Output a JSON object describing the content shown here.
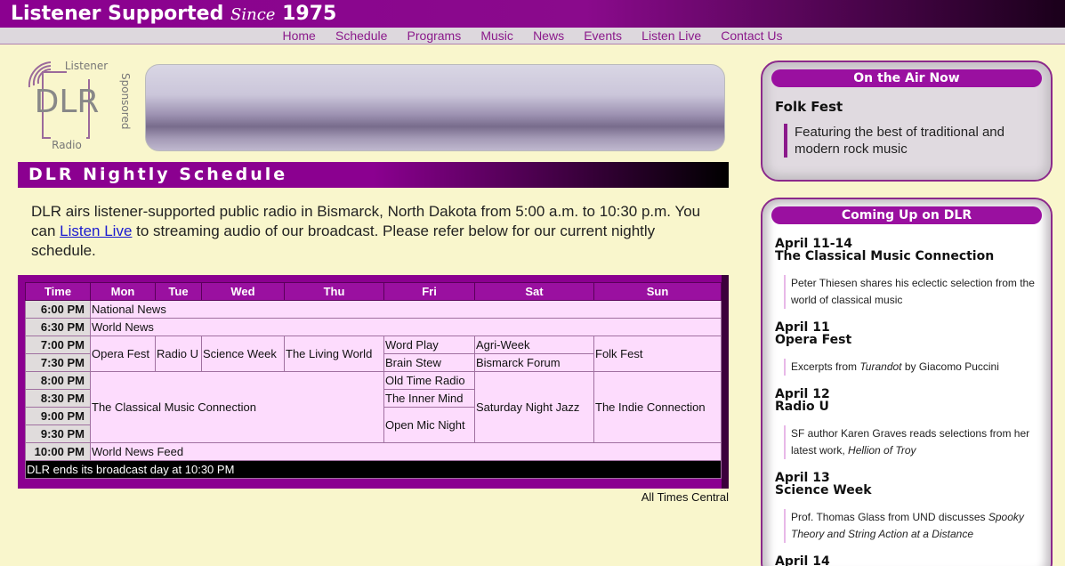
{
  "header": {
    "title": "Listener Supported",
    "since": "Since",
    "year": "1975"
  },
  "nav": [
    "Home",
    "Schedule",
    "Programs",
    "Music",
    "News",
    "Events",
    "Listen Live",
    "Contact Us"
  ],
  "logo": {
    "top": "Listener",
    "mid": "DLR",
    "side": "Sponsored",
    "bottom": "Radio"
  },
  "schedule_title": "DLR Nightly Schedule",
  "intro": {
    "before": "DLR airs listener-supported public radio in Bismarck, North Dakota from 5:00 a.m. to 10:30 p.m. You can ",
    "link": "Listen Live",
    "after": " to streaming audio of our broadcast. Please refer below for our current nightly schedule."
  },
  "table": {
    "headers": [
      "Time",
      "Mon",
      "Tue",
      "Wed",
      "Thu",
      "Fri",
      "Sat",
      "Sun"
    ],
    "times": [
      "6:00 PM",
      "6:30 PM",
      "7:00 PM",
      "7:30 PM",
      "8:00 PM",
      "8:30 PM",
      "9:00 PM",
      "9:30 PM",
      "10:00 PM"
    ],
    "programs": {
      "national_news": "National News",
      "world_news": "World News",
      "opera_fest": "Opera Fest",
      "radio_u": "Radio U",
      "science_week": "Science Week",
      "living_world": "The Living World",
      "word_play": "Word Play",
      "agri_week": "Agri-Week",
      "folk_fest": "Folk Fest",
      "brain_stew": "Brain Stew",
      "bismarck_forum": "Bismarck Forum",
      "classical": "The Classical Music Connection",
      "old_time_radio": "Old Time Radio",
      "sat_jazz": "Saturday Night Jazz",
      "indie": "The Indie Connection",
      "inner_mind": "The Inner Mind",
      "open_mic": "Open Mic Night",
      "world_news_feed": "World News Feed"
    },
    "end_note": "DLR ends its broadcast day at 10:30 PM"
  },
  "all_times": "All Times Central",
  "on_air": {
    "heading": "On the Air Now",
    "show": "Folk Fest",
    "description": "Featuring the best of traditional and modern rock music"
  },
  "coming_up": {
    "heading": "Coming Up on DLR",
    "items": [
      {
        "date": "April 11-14",
        "title": "The Classical Music Connection",
        "desc": "Peter Thiesen shares his eclectic selection from the world of classical music"
      },
      {
        "date": "April 11",
        "title": "Opera Fest",
        "desc_pre": "Excerpts from ",
        "desc_em": "Turandot",
        "desc_post": " by Giacomo Puccini"
      },
      {
        "date": "April 12",
        "title": "Radio U",
        "desc_pre": "SF author Karen Graves reads selections from her latest work, ",
        "desc_em": "Hellion of Troy",
        "desc_post": ""
      },
      {
        "date": "April 13",
        "title": "Science Week",
        "desc_pre": "Prof. Thomas Glass from UND discusses ",
        "desc_em": "Spooky Theory and String Action at a Distance",
        "desc_post": ""
      },
      {
        "date": "April 14"
      }
    ]
  },
  "colors": {
    "purple": "#8b0090",
    "background": "#f9f6cc",
    "cell": "#fddcfd"
  }
}
